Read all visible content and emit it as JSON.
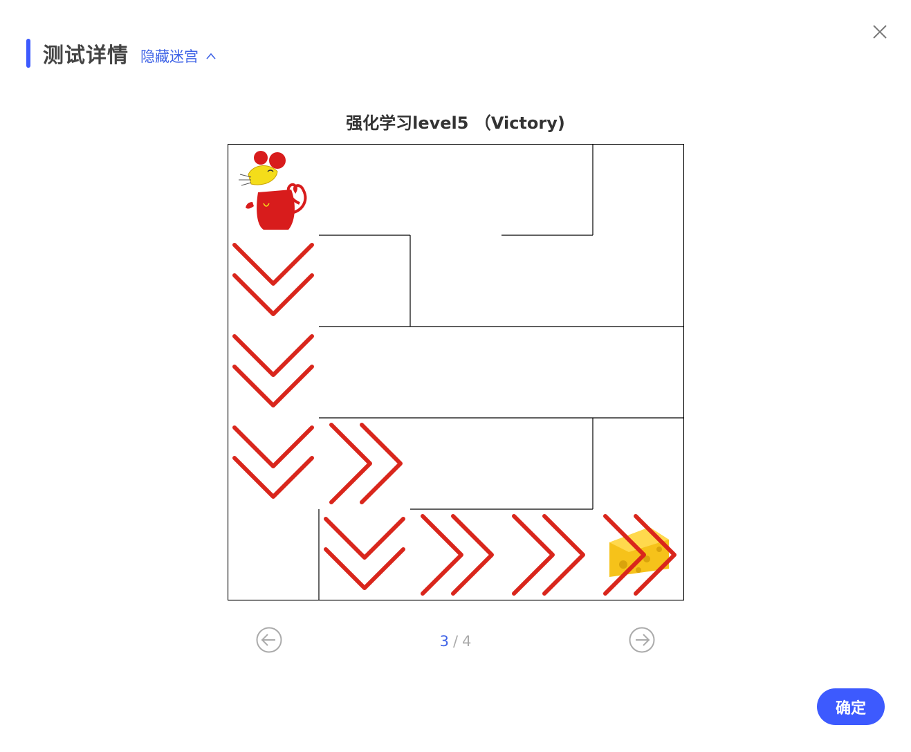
{
  "header": {
    "title": "测试详情",
    "toggle_label": "隐藏迷宫",
    "close_icon": "close-icon"
  },
  "maze": {
    "title": "强化学习level5 （Victory)",
    "grid_size": 5,
    "start": {
      "row": 0,
      "col": 0,
      "icon": "mouse-icon"
    },
    "goal": {
      "row": 4,
      "col": 4,
      "icon": "cheese-icon"
    },
    "path": [
      {
        "row": 1,
        "col": 0,
        "dir": "down"
      },
      {
        "row": 2,
        "col": 0,
        "dir": "down"
      },
      {
        "row": 3,
        "col": 0,
        "dir": "down"
      },
      {
        "row": 3,
        "col": 1,
        "dir": "right"
      },
      {
        "row": 4,
        "col": 1,
        "dir": "down"
      },
      {
        "row": 4,
        "col": 2,
        "dir": "right"
      },
      {
        "row": 4,
        "col": 3,
        "dir": "right"
      },
      {
        "row": 4,
        "col": 4,
        "dir": "right"
      }
    ],
    "arrow_color": "#d9261c"
  },
  "pager": {
    "current": "3",
    "separator": "/",
    "total": "4",
    "prev_icon": "arrow-left-circle-icon",
    "next_icon": "arrow-right-circle-icon"
  },
  "footer": {
    "confirm_label": "确定"
  },
  "colors": {
    "accent": "#3d5afe",
    "link": "#3f63e6",
    "muted": "#aaaaaa",
    "wall": "#000000"
  }
}
